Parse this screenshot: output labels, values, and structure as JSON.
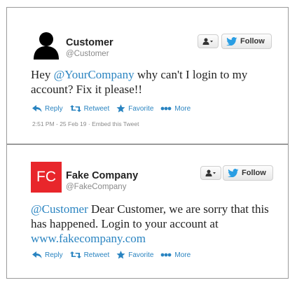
{
  "tweets": [
    {
      "user_name": "Customer",
      "user_handle": "@Customer",
      "text_mention": "@YourCompany",
      "text_before": "Hey ",
      "text_after": " why can't I login to my account? Fix it please!!",
      "actions": {
        "reply": "Reply",
        "retweet": "Retweet",
        "favorite": "Favorite",
        "more": "More"
      },
      "follow_label": "Follow",
      "timestamp": "2:51 PM - 25 Feb 19",
      "separator": " · ",
      "embed_label": "Embed this Tweet"
    },
    {
      "user_name": "Fake Company",
      "user_handle": "@FakeCompany",
      "avatar_text": "FC",
      "text_mention": "@Customer",
      "text_middle": " Dear Customer, we are sorry that this has happened. Login to your account at ",
      "text_link": "www.fakecompany.com",
      "actions": {
        "reply": "Reply",
        "retweet": "Retweet",
        "favorite": "Favorite",
        "more": "More"
      },
      "follow_label": "Follow"
    }
  ],
  "colors": {
    "link": "#2a84c1",
    "fc_avatar": "#e8262b",
    "handle": "#8a8a8a"
  }
}
